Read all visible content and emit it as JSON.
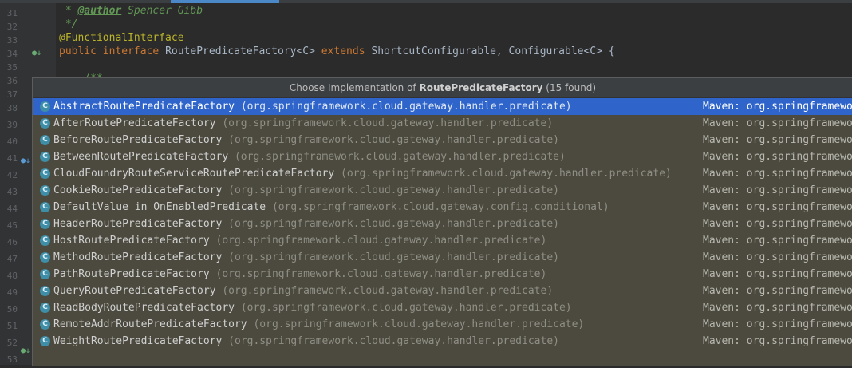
{
  "editor": {
    "line_numbers": [
      "31",
      "32",
      "33",
      "34",
      "35",
      "36",
      "37",
      "38",
      "39",
      "40",
      "41",
      "42",
      "43",
      "44",
      "45",
      "46",
      "47",
      "48",
      "49",
      "50",
      "51",
      "52",
      "53",
      "54",
      "55",
      "56"
    ],
    "line31": {
      "prefix": " * ",
      "tag": "@author",
      "rest": " Spencer Gibb"
    },
    "line32": " */",
    "line33": "@FunctionalInterface",
    "line34": {
      "kw_public": "public",
      "kw_interface": "interface",
      "name": "RoutePredicateFactory<C>",
      "kw_extends": "extends",
      "rest": "ShortcutConfigurable, Configurable<C> {"
    },
    "line37": "    /**"
  },
  "popup": {
    "title_prefix": "Choose Implementation of ",
    "title_target": "RoutePredicateFactory",
    "title_suffix": " (15 found)",
    "items": [
      {
        "name": "AbstractRoutePredicateFactory",
        "pkg": "(org.springframework.cloud.gateway.handler.predicate)",
        "location": "Maven: org.springframewo"
      },
      {
        "name": "AfterRoutePredicateFactory",
        "pkg": "(org.springframework.cloud.gateway.handler.predicate)",
        "location": "Maven: org.springframewo"
      },
      {
        "name": "BeforeRoutePredicateFactory",
        "pkg": "(org.springframework.cloud.gateway.handler.predicate)",
        "location": "Maven: org.springframewo"
      },
      {
        "name": "BetweenRoutePredicateFactory",
        "pkg": "(org.springframework.cloud.gateway.handler.predicate)",
        "location": "Maven: org.springframewo"
      },
      {
        "name": "CloudFoundryRouteServiceRoutePredicateFactory",
        "pkg": "(org.springframework.cloud.gateway.handler.predicate)",
        "location": "Maven: org.springframewo"
      },
      {
        "name": "CookieRoutePredicateFactory",
        "pkg": "(org.springframework.cloud.gateway.handler.predicate)",
        "location": "Maven: org.springframewo"
      },
      {
        "name": "DefaultValue in OnEnabledPredicate",
        "pkg": "(org.springframework.cloud.gateway.config.conditional)",
        "location": "Maven: org.springframewo"
      },
      {
        "name": "HeaderRoutePredicateFactory",
        "pkg": "(org.springframework.cloud.gateway.handler.predicate)",
        "location": "Maven: org.springframewo"
      },
      {
        "name": "HostRoutePredicateFactory",
        "pkg": "(org.springframework.cloud.gateway.handler.predicate)",
        "location": "Maven: org.springframewo"
      },
      {
        "name": "MethodRoutePredicateFactory",
        "pkg": "(org.springframework.cloud.gateway.handler.predicate)",
        "location": "Maven: org.springframewo"
      },
      {
        "name": "PathRoutePredicateFactory",
        "pkg": "(org.springframework.cloud.gateway.handler.predicate)",
        "location": "Maven: org.springframewo"
      },
      {
        "name": "QueryRoutePredicateFactory",
        "pkg": "(org.springframework.cloud.gateway.handler.predicate)",
        "location": "Maven: org.springframewo"
      },
      {
        "name": "ReadBodyRoutePredicateFactory",
        "pkg": "(org.springframework.cloud.gateway.handler.predicate)",
        "location": "Maven: org.springframewo"
      },
      {
        "name": "RemoteAddrRoutePredicateFactory",
        "pkg": "(org.springframework.cloud.gateway.handler.predicate)",
        "location": "Maven: org.springframewo"
      },
      {
        "name": "WeightRoutePredicateFactory",
        "pkg": "(org.springframework.cloud.gateway.handler.predicate)",
        "location": "Maven: org.springframewo"
      }
    ]
  },
  "colors": {
    "editor_bg": "#2b2b2b",
    "popup_bg": "#4c4a3e",
    "selection": "#2f65ca",
    "keyword": "#cc7832",
    "annotation": "#bbb529",
    "doc_comment": "#629755"
  }
}
